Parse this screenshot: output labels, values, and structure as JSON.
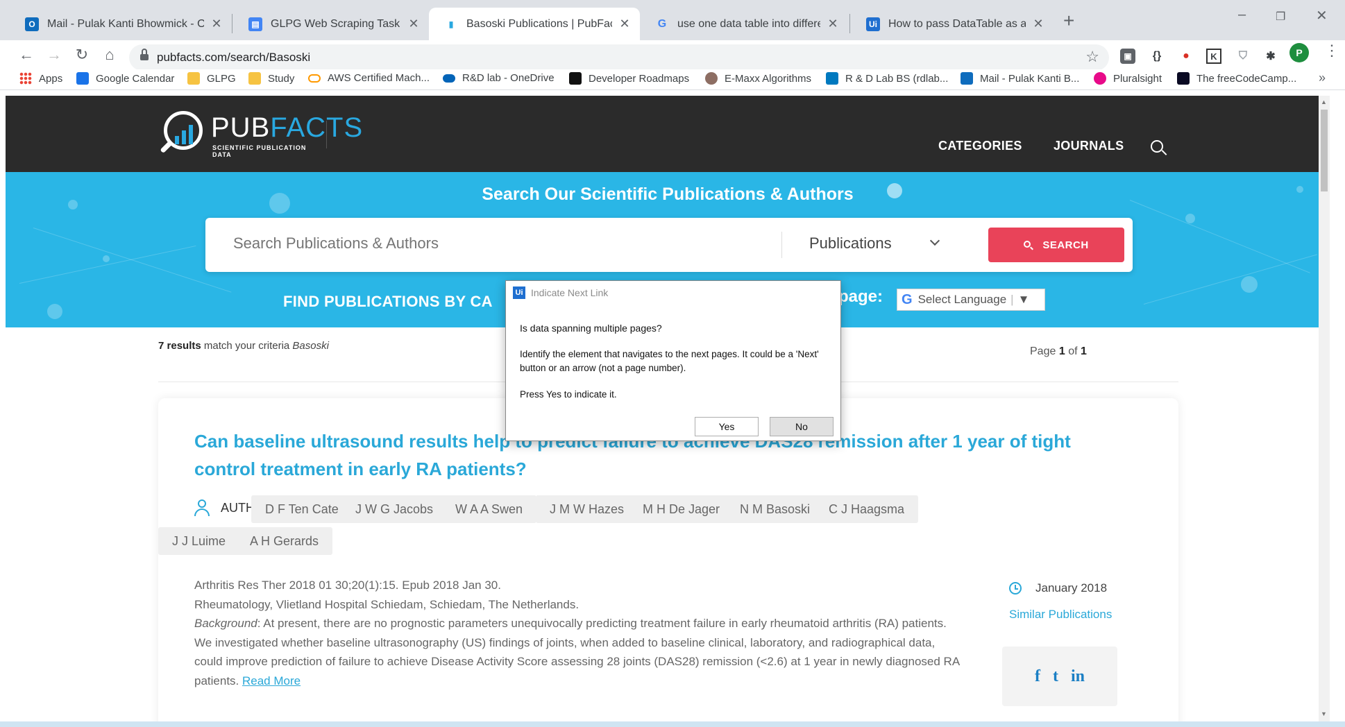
{
  "browser": {
    "tabs": [
      {
        "title": "Mail - Pulak Kanti Bhowmick - O",
        "icon": "outlook-icon",
        "color": "#0f6cbd"
      },
      {
        "title": "GLPG Web Scraping Task Estimat",
        "icon": "docs-icon",
        "color": "#4285f4"
      },
      {
        "title": "Basoski Publications | PubFacts",
        "icon": "pubfacts-icon",
        "color": "#29a8e0",
        "active": true
      },
      {
        "title": "use one data table into different",
        "icon": "google-icon",
        "color": "#4285f4"
      },
      {
        "title": "How to pass DataTable as an arg",
        "icon": "uipath-icon",
        "color": "#1f6fd0"
      }
    ],
    "new_tab": "+",
    "url": "pubfacts.com/search/Basoski",
    "profile_initial": "P",
    "extensions": [
      "{}",
      "K"
    ],
    "bookmarks": [
      {
        "label": "Apps",
        "icon": "apps-icon",
        "color": "#ea4335"
      },
      {
        "label": "Google Calendar",
        "icon": "calendar-icon",
        "color": "#1a73e8"
      },
      {
        "label": "GLPG",
        "icon": "folder-icon",
        "color": "#f6c342"
      },
      {
        "label": "Study",
        "icon": "folder-icon",
        "color": "#f6c342"
      },
      {
        "label": "AWS Certified Mach...",
        "icon": "aws-icon",
        "color": "#ff9900"
      },
      {
        "label": "R&D lab - OneDrive",
        "icon": "onedrive-icon",
        "color": "#0364b8"
      },
      {
        "label": "Developer Roadmaps",
        "icon": "roadmap-icon",
        "color": "#111111"
      },
      {
        "label": "E-Maxx Algorithms",
        "icon": "emaxx-icon",
        "color": "#8d6e63"
      },
      {
        "label": "R & D Lab BS (rdlab...",
        "icon": "trello-icon",
        "color": "#0079bf"
      },
      {
        "label": "Mail - Pulak Kanti B...",
        "icon": "outlook-icon",
        "color": "#0f6cbd"
      },
      {
        "label": "Pluralsight",
        "icon": "pluralsight-icon",
        "color": "#e80a89"
      },
      {
        "label": "The freeCodeCamp...",
        "icon": "freecodecamp-icon",
        "color": "#0a0a23"
      }
    ],
    "bookmarks_more": "»"
  },
  "site": {
    "logo_word_1": "PUB",
    "logo_word_2": "FACTS",
    "logo_tagline": "SCIENTIFIC PUBLICATION DATA",
    "nav": [
      "CATEGORIES",
      "JOURNALS"
    ],
    "hero_title": "Search Our Scientific Publications & Authors",
    "search_placeholder": "Search Publications & Authors",
    "search_type": "Publications",
    "search_button": "SEARCH",
    "find_text": "FIND PUBLICATIONS BY CA",
    "page_text": "page:",
    "language": "Select Language",
    "brand_color": "#2ab6e6",
    "accent_red": "#e94359"
  },
  "results": {
    "count": "7 results",
    "match_text": "match your criteria",
    "query": "Basoski",
    "page_label": "Page",
    "page_current": "1",
    "page_of": "of",
    "page_total": "1"
  },
  "article": {
    "title": "Can baseline ultrasound results help to predict failure to achieve DAS28 remission after 1 year of tight control treatment in early RA patients?",
    "authors_label": "AUTHORS:",
    "authors": [
      "D F Ten Cate",
      "J W G Jacobs",
      "W A A Swen",
      "J M W Hazes",
      "M H De Jager",
      "N M Basoski",
      "C J Haagsma",
      "J J Luime",
      "A H Gerards"
    ],
    "citation": "Arthritis Res Ther 2018 01 30;20(1):15. Epub 2018 Jan 30.",
    "affiliation": "Rheumatology, Vlietland Hospital Schiedam, Schiedam, The Netherlands.",
    "background_label": "Background",
    "abstract": ": At present, there are no prognostic parameters unequivocally predicting treatment failure in early rheumatoid arthritis (RA) patients. We investigated whether baseline ultrasonography (US) findings of joints, when added to baseline clinical, laboratory, and radiographical data, could improve prediction of failure to achieve Disease Activity Score assessing 28 joints (DAS28) remission (<2.6) at 1 year in newly diagnosed RA patients.",
    "read_more": "Read More",
    "date": "January 2018",
    "similar": "Similar Publications",
    "share": [
      "f",
      "t",
      "in"
    ]
  },
  "dialog": {
    "title": "Indicate Next Link",
    "logo": "Ui",
    "question": "Is data spanning multiple pages?",
    "body": "Identify the element that navigates to the next pages. It could be a 'Next' button or an arrow (not a page number).",
    "press": "Press Yes to indicate it.",
    "yes": "Yes",
    "no": "No"
  }
}
